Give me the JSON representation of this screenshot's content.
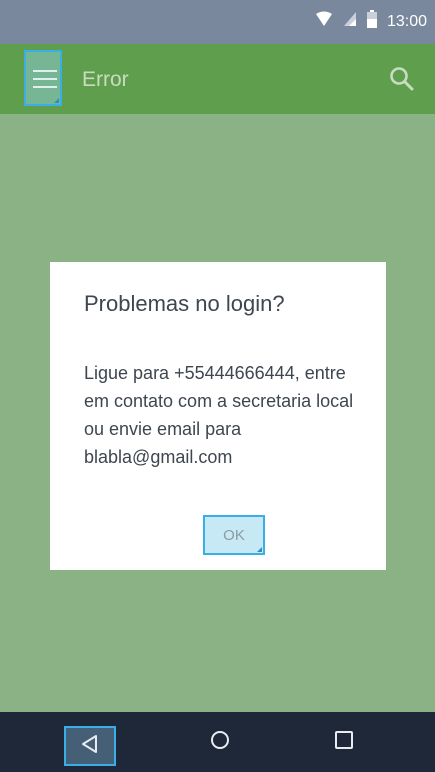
{
  "status_bar": {
    "time": "13:00",
    "icons": [
      "wifi-icon",
      "signal-icon",
      "battery-icon"
    ]
  },
  "app_bar": {
    "title": "Error",
    "menu_icon": "hamburger-menu-icon",
    "search_icon": "search-icon",
    "color": "#5e9e4c"
  },
  "dialog": {
    "title": "Problemas no login?",
    "message": "Ligue para +55444666444, entre em contato com a secretaria local ou envie email para blabla@gmail.com",
    "ok_label": "OK"
  },
  "nav_bar": {
    "icons": [
      "back-icon",
      "home-icon",
      "recents-icon"
    ]
  },
  "colors": {
    "accent_highlight": "#3aaee6",
    "scrim": "#8bb284",
    "status_bar": "#7a889e",
    "nav_bar": "#1e2838"
  }
}
